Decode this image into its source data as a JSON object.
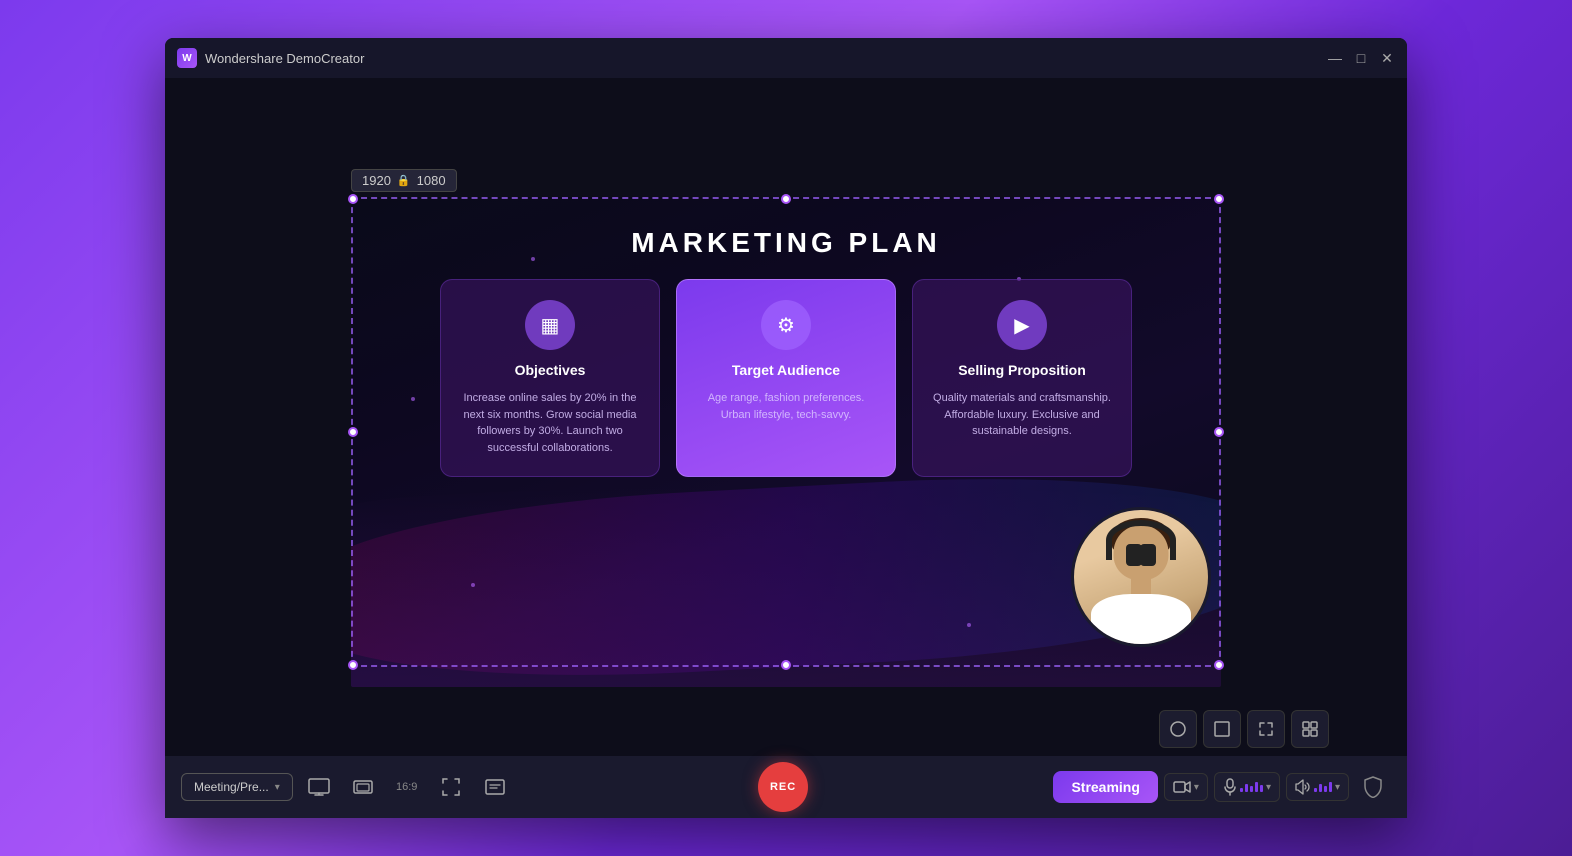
{
  "window": {
    "title": "Wondershare DemoCreator",
    "app_icon_text": "W",
    "controls": {
      "minimize": "—",
      "maximize": "□",
      "close": "✕"
    }
  },
  "canvas": {
    "resolution_width": "1920",
    "resolution_height": "1080",
    "lock_icon": "🔒"
  },
  "slide": {
    "title": "MARKETING PLAN",
    "card1": {
      "title": "Objectives",
      "body": "Increase online sales by 20% in the next six months. Grow social media followers by 30%. Launch two successful collaborations.",
      "icon": "▦"
    },
    "card2": {
      "title": "Target Audience",
      "body": "Age range, fashion preferences. Urban lifestyle, tech-savvy.",
      "icon": "⚙"
    },
    "card3": {
      "title": "Selling Proposition",
      "body": "Quality materials and craftsmanship. Affordable luxury. Exclusive and sustainable designs.",
      "icon": "▶"
    }
  },
  "toolbar": {
    "preset_label": "Meeting/Pre...",
    "ratio": "16:9",
    "rec_label": "REC",
    "streaming_label": "Streaming",
    "icons": {
      "screen": "🖥",
      "window": "▭",
      "aspect": "16:9",
      "custom": "✂",
      "text": "▤"
    }
  },
  "controls_overlay": {
    "circle_icon": "○",
    "square_icon": "□",
    "expand_icon": "⛶",
    "layout_icon": "▦"
  }
}
